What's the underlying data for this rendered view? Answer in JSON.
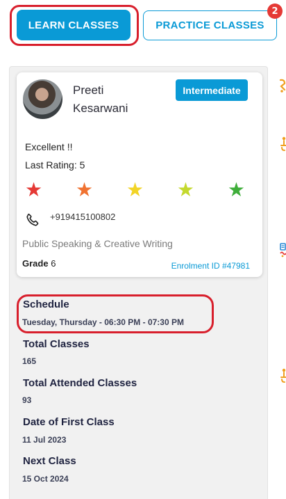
{
  "tabs": {
    "learn_label": "LEARN CLASSES",
    "practice_label": "PRACTICE CLASSES",
    "practice_badge": "2"
  },
  "teacher": {
    "name_line1": "Preeti",
    "name_line2": "Kesarwani",
    "level": "Intermediate",
    "feedback": "Excellent !!",
    "last_rating": "Last Rating: 5",
    "phone": "+919415100802",
    "course": "Public Speaking & Creative Writing",
    "grade_label": "Grade",
    "grade_value": "6",
    "enrolment": "Enrolment ID #47981",
    "rating_value": 5,
    "stars": [
      {
        "glyph": "★",
        "color": "#e53935"
      },
      {
        "glyph": "★",
        "color": "#f07231"
      },
      {
        "glyph": "★",
        "color": "#f2d426"
      },
      {
        "glyph": "★",
        "color": "#c4d92e"
      },
      {
        "glyph": "★",
        "color": "#3fae3a"
      }
    ]
  },
  "details": {
    "schedule_label": "Schedule",
    "schedule_value": "Tuesday, Thursday - 06:30 PM - 07:30 PM",
    "total_label": "Total Classes",
    "total_value": "165",
    "attended_label": "Total Attended Classes",
    "attended_value": "93",
    "first_label": "Date of First Class",
    "first_value": "11 Jul 2023",
    "next_label": "Next Class",
    "next_value": "15 Oct 2024"
  },
  "colors": {
    "primary": "#0a9ad6",
    "annotation": "#d81f2c",
    "badge": "#e53935",
    "edge_icons": "#f0a020"
  }
}
